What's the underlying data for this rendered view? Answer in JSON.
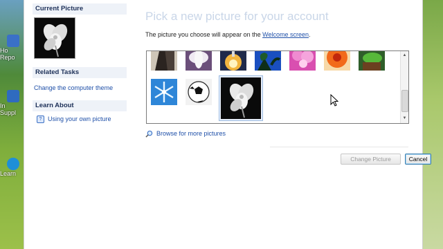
{
  "desktop": {
    "icons": [
      {
        "label": "Ho Repo"
      },
      {
        "label": "In Suppl"
      },
      {
        "label": "Learn"
      }
    ]
  },
  "sidebar": {
    "current_picture_heading": "Current Picture",
    "related_tasks_heading": "Related Tasks",
    "change_theme_link": "Change the computer theme",
    "learn_about_heading": "Learn About",
    "own_picture_link": "Using your own picture"
  },
  "main": {
    "title": "Pick a new picture for your account",
    "description_prefix": "The picture you choose will appear on the ",
    "description_link": "Welcome screen",
    "description_suffix": ".",
    "pictures": [
      {
        "name": "horse",
        "selected": false
      },
      {
        "name": "flower-white-purple",
        "selected": false
      },
      {
        "name": "rocket-launch",
        "selected": false
      },
      {
        "name": "palm-trees",
        "selected": false
      },
      {
        "name": "pink-flower",
        "selected": false
      },
      {
        "name": "orange-flower",
        "selected": false
      },
      {
        "name": "green-chameleon",
        "selected": false
      },
      {
        "name": "snowflake",
        "selected": false
      },
      {
        "name": "soccer-ball",
        "selected": false
      },
      {
        "name": "white-flower",
        "selected": true
      }
    ],
    "browse_link": "Browse for more pictures",
    "change_picture_button": "Change Picture",
    "cancel_button": "Cancel"
  }
}
